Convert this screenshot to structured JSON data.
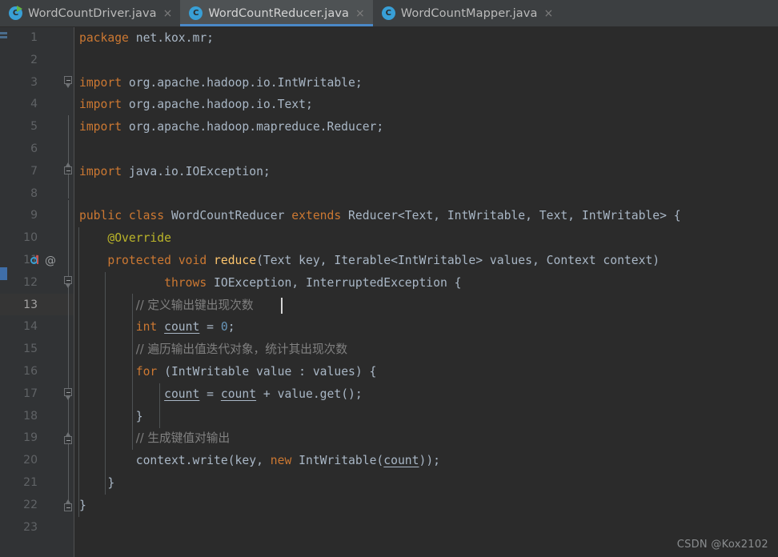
{
  "window": {
    "app": "IntelliJ IDEA Editor",
    "theme_background": "#2b2b2b",
    "accent_color": "#4a88c7"
  },
  "tabs": [
    {
      "label": "WordCountDriver.java",
      "icon": "java-class-runnable-icon",
      "close": "×",
      "active": false
    },
    {
      "label": "WordCountReducer.java",
      "icon": "java-class-icon",
      "close": "×",
      "active": true
    },
    {
      "label": "WordCountMapper.java",
      "icon": "java-class-icon",
      "close": "×",
      "active": false
    }
  ],
  "editor": {
    "current_line": 13,
    "total_lines": 23,
    "line_numbers": [
      "1",
      "2",
      "3",
      "4",
      "5",
      "6",
      "7",
      "8",
      "9",
      "10",
      "11",
      "12",
      "13",
      "14",
      "15",
      "16",
      "17",
      "18",
      "19",
      "20",
      "21",
      "22",
      "23"
    ],
    "lines": [
      {
        "n": "1",
        "text": "package net.kox.mr;"
      },
      {
        "n": "2",
        "text": ""
      },
      {
        "n": "3",
        "text": "import org.apache.hadoop.io.IntWritable;"
      },
      {
        "n": "4",
        "text": "import org.apache.hadoop.io.Text;"
      },
      {
        "n": "5",
        "text": "import org.apache.hadoop.mapreduce.Reducer;"
      },
      {
        "n": "6",
        "text": ""
      },
      {
        "n": "7",
        "text": "import java.io.IOException;"
      },
      {
        "n": "8",
        "text": ""
      },
      {
        "n": "9",
        "text": "public class WordCountReducer extends Reducer<Text, IntWritable, Text, IntWritable> {"
      },
      {
        "n": "10",
        "text": "    @Override"
      },
      {
        "n": "11",
        "text": "    protected void reduce(Text key, Iterable<IntWritable> values, Context context)"
      },
      {
        "n": "12",
        "text": "            throws IOException, InterruptedException {"
      },
      {
        "n": "13",
        "text": "        // 定义输出键出现次数"
      },
      {
        "n": "14",
        "text": "        int count = 0;"
      },
      {
        "n": "15",
        "text": "        // 遍历输出值迭代对象，统计其出现次数"
      },
      {
        "n": "16",
        "text": "        for (IntWritable value : values) {"
      },
      {
        "n": "17",
        "text": "            count = count + value.get();"
      },
      {
        "n": "18",
        "text": "        }"
      },
      {
        "n": "19",
        "text": "        // 生成键值对输出"
      },
      {
        "n": "20",
        "text": "        context.write(key, new IntWritable(count));"
      },
      {
        "n": "21",
        "text": "    }"
      },
      {
        "n": "22",
        "text": "}"
      },
      {
        "n": "23",
        "text": ""
      }
    ],
    "tokens": {
      "kw_package": "package",
      "kw_import": "import",
      "kw_public": "public",
      "kw_class": "class",
      "kw_extends": "extends",
      "kw_protected": "protected",
      "kw_void": "void",
      "kw_throws": "throws",
      "kw_int": "int",
      "kw_for": "for",
      "kw_new": "new",
      "pkg_name": "net.kox.mr;",
      "imp_intwritable": "org.apache.hadoop.io.IntWritable;",
      "imp_text": "org.apache.hadoop.io.Text;",
      "imp_reducer": "org.apache.hadoop.mapreduce.Reducer;",
      "imp_ioexception": "java.io.IOException;",
      "class_name": "WordCountReducer",
      "super_decl": "Reducer<Text, IntWritable, Text, IntWritable> {",
      "annotation_override": "@Override",
      "method_name": "reduce",
      "method_params": "(Text key, Iterable<IntWritable> values, Context context)",
      "throws_clause": "IOException, InterruptedException {",
      "comment_define_count": "// 定义输出键出现次数",
      "comment_iterate": "// 遍历输出值迭代对象，统计其出现次数",
      "comment_emit": "// 生成键值对输出",
      "var_count": "count",
      "num_zero": "0",
      "decl_count_tail": " = ",
      "semicolon": ";",
      "for_header": "(IntWritable value : values) {",
      "assign_mid": " = ",
      "assign_tail": " + value.get();",
      "close_brace": "}",
      "context_write_head": "context.write(key, ",
      "context_write_type": "IntWritable(",
      "context_write_tail": "));"
    },
    "gutter_icons": {
      "line11_override": "override-method-icon",
      "line11_annotation": "@",
      "fold_line3": "fold-collapse-icon",
      "fold_line7": "fold-collapse-icon",
      "fold_line12": "fold-collapse-icon",
      "fold_line16": "fold-collapse-icon",
      "fold_line18": "fold-collapse-icon",
      "fold_line21": "fold-collapse-icon"
    }
  },
  "watermark": {
    "text": "CSDN @Kox2102"
  }
}
